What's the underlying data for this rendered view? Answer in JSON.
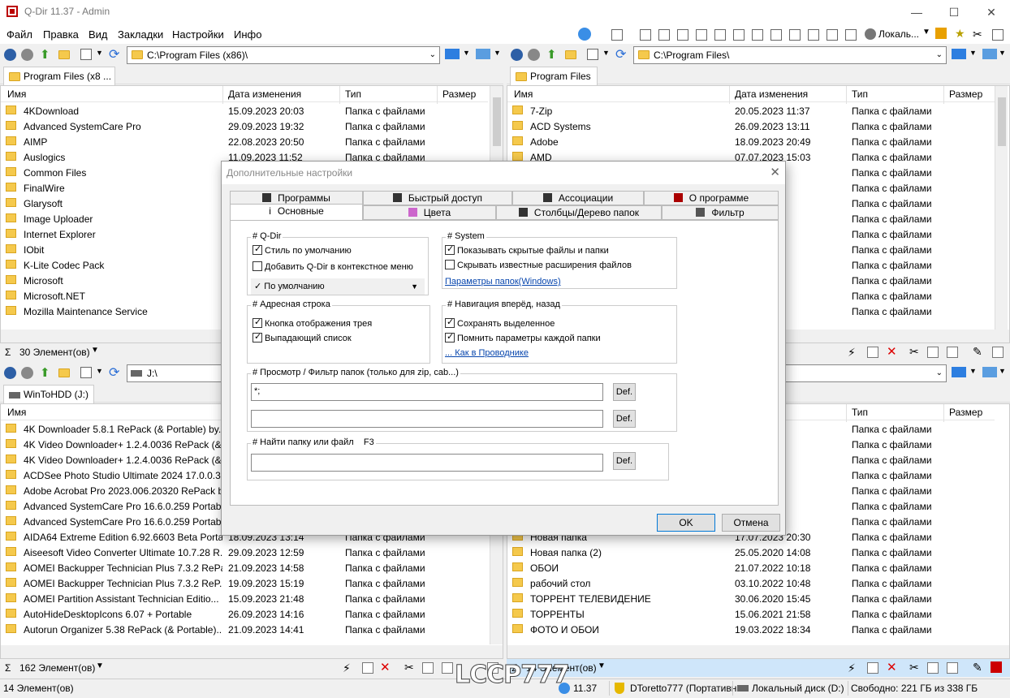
{
  "app": {
    "title": "Q-Dir 11.37 - Admin",
    "min": "—",
    "max": "☐",
    "close": "✕"
  },
  "menu": [
    "Файл",
    "Правка",
    "Вид",
    "Закладки",
    "Настройки",
    "Инфо"
  ],
  "toolbar": {
    "locale_label": "Локаль..."
  },
  "columns": {
    "name": "Имя",
    "date": "Дата изменения",
    "type": "Тип",
    "size": "Размер"
  },
  "pane_tl": {
    "path": "C:\\Program Files (x86)\\",
    "tab": "Program Files (x8 ...",
    "rows": [
      {
        "name": "4KDownload",
        "date": "15.09.2023 20:03",
        "type": "Папка с файлами"
      },
      {
        "name": "Advanced SystemCare Pro",
        "date": "29.09.2023 19:32",
        "type": "Папка с файлами"
      },
      {
        "name": "AIMP",
        "date": "22.08.2023 20:50",
        "type": "Папка с файлами"
      },
      {
        "name": "Auslogics",
        "date": "11.09.2023 11:52",
        "type": "Папка с файлами"
      },
      {
        "name": "Common Files",
        "date": "",
        "type": ""
      },
      {
        "name": "FinalWire",
        "date": "",
        "type": ""
      },
      {
        "name": "Glarysoft",
        "date": "",
        "type": ""
      },
      {
        "name": "Image Uploader",
        "date": "",
        "type": ""
      },
      {
        "name": "Internet Explorer",
        "date": "",
        "type": ""
      },
      {
        "name": "IObit",
        "date": "",
        "type": ""
      },
      {
        "name": "K-Lite Codec Pack",
        "date": "",
        "type": ""
      },
      {
        "name": "Microsoft",
        "date": "",
        "type": ""
      },
      {
        "name": "Microsoft.NET",
        "date": "",
        "type": ""
      },
      {
        "name": "Mozilla Maintenance Service",
        "date": "",
        "type": ""
      }
    ],
    "status": "30 Элемент(ов)"
  },
  "pane_tr": {
    "path": "C:\\Program Files\\",
    "tab": "Program Files",
    "rows": [
      {
        "name": "7-Zip",
        "date": "20.05.2023 11:37",
        "type": "Папка с файлами"
      },
      {
        "name": "ACD Systems",
        "date": "26.09.2023 13:11",
        "type": "Папка с файлами"
      },
      {
        "name": "Adobe",
        "date": "18.09.2023 20:49",
        "type": "Папка с файлами"
      },
      {
        "name": "AMD",
        "date": "07.07.2023 15:03",
        "type": "Папка с файлами"
      },
      {
        "name": "",
        "date": ":57",
        "type": "Папка с файлами"
      },
      {
        "name": "",
        "date": ":22",
        "type": "Папка с файлами"
      },
      {
        "name": "",
        "date": ":20",
        "type": "Папка с файлами"
      },
      {
        "name": "",
        "date": ":40",
        "type": "Папка с файлами"
      },
      {
        "name": "",
        "date": ":17",
        "type": "Папка с файлами"
      },
      {
        "name": "",
        "date": ":22",
        "type": "Папка с файлами"
      },
      {
        "name": "",
        "date": ":55",
        "type": "Папка с файлами"
      },
      {
        "name": "",
        "date": ":58",
        "type": "Папка с файлами"
      },
      {
        "name": "",
        "date": ":06",
        "type": "Папка с файлами"
      },
      {
        "name": "",
        "date": ":03",
        "type": "Папка с файлами"
      }
    ]
  },
  "pane_bl": {
    "path": "J:\\",
    "tab": "WinToHDD (J:)",
    "rows": [
      {
        "name": "4K Downloader 5.8.1 RePack (& Portable) by...",
        "date": "",
        "type": ""
      },
      {
        "name": "4K Video Downloader+ 1.2.4.0036 RePack (&...",
        "date": "",
        "type": ""
      },
      {
        "name": "4K Video Downloader+ 1.2.4.0036 RePack (&...",
        "date": "",
        "type": ""
      },
      {
        "name": "ACDSee Photo Studio Ultimate 2024 17.0.0.3...",
        "date": "",
        "type": ""
      },
      {
        "name": "Adobe Acrobat Pro 2023.006.20320 RePack b...",
        "date": "",
        "type": ""
      },
      {
        "name": "Advanced SystemCare Pro 16.6.0.259 Portab...",
        "date": "",
        "type": ""
      },
      {
        "name": "Advanced SystemCare Pro 16.6.0.259 Portab...",
        "date": "",
        "type": ""
      },
      {
        "name": "AIDA64 Extreme Edition 6.92.6603 Beta Porta...",
        "date": "18.09.2023 13:14",
        "type": "Папка с файлами"
      },
      {
        "name": "Aiseesoft Video Converter Ultimate 10.7.28 R...",
        "date": "29.09.2023 12:59",
        "type": "Папка с файлами"
      },
      {
        "name": "AOMEI Backupper Technician Plus 7.3.2 RePa...",
        "date": "21.09.2023 14:58",
        "type": "Папка с файлами"
      },
      {
        "name": "AOMEI Backupper Technician Plus 7.3.2 ReP...",
        "date": "19.09.2023 15:19",
        "type": "Папка с файлами"
      },
      {
        "name": "AOMEI Partition Assistant Technician Editio...",
        "date": "15.09.2023 21:48",
        "type": "Папка с файлами"
      },
      {
        "name": "AutoHideDesktopIcons 6.07 + Portable",
        "date": "26.09.2023 14:16",
        "type": "Папка с файлами"
      },
      {
        "name": "Autorun Organizer 5.38 RePack (& Portable)...",
        "date": "21.09.2023 14:41",
        "type": "Папка с файлами"
      }
    ],
    "status": "162 Элемент(ов)"
  },
  "pane_br": {
    "rows": [
      {
        "name": "",
        "date": ":29",
        "type": "Папка с файлами"
      },
      {
        "name": "",
        "date": ":14",
        "type": "Папка с файлами"
      },
      {
        "name": "",
        "date": ":17",
        "type": "Папка с файлами"
      },
      {
        "name": "",
        "date": ":29",
        "type": "Папка с файлами"
      },
      {
        "name": "",
        "date": ":38",
        "type": "Папка с файлами"
      },
      {
        "name": "",
        "date": ":29",
        "type": "Папка с файлами"
      },
      {
        "name": "",
        "date": ":24",
        "type": "Папка с файлами"
      },
      {
        "name": "Новая папка",
        "date": "17.07.2023 20:30",
        "type": "Папка с файлами"
      },
      {
        "name": "Новая папка (2)",
        "date": "25.05.2020 14:08",
        "type": "Папка с файлами"
      },
      {
        "name": "ОБОИ",
        "date": "21.07.2022 10:18",
        "type": "Папка с файлами"
      },
      {
        "name": "рабочий стол",
        "date": "03.10.2022 10:48",
        "type": "Папка с файлами"
      },
      {
        "name": "ТОРРЕНТ ТЕЛЕВИДЕНИЕ",
        "date": "30.06.2020 15:45",
        "type": "Папка с файлами"
      },
      {
        "name": "ТОРРЕНТЫ",
        "date": "15.06.2021 21:58",
        "type": "Папка с файлами"
      },
      {
        "name": "ФОТО И ОБОИ",
        "date": "19.03.2022 18:34",
        "type": "Папка с файлами"
      }
    ],
    "status": "14 Элемент(ов)"
  },
  "dialog": {
    "title": "Дополнительные настройки",
    "tabs_row1": [
      "Программы",
      "Быстрый доступ",
      "Ассоциации",
      "О программе"
    ],
    "tabs_row2": [
      "Основные",
      "Цвета",
      "Столбцы/Дерево папок",
      "Фильтр"
    ],
    "qdir": {
      "title": "# Q-Dir",
      "opt1": "Стиль по умолчанию",
      "opt2": "Добавить Q-Dir в контекстное меню",
      "combo": "По умолчанию"
    },
    "system": {
      "title": "# System",
      "opt1": "Показывать скрытые файлы и папки",
      "opt2": "Скрывать известные расширения файлов",
      "link": "Параметры папок(Windows)"
    },
    "address": {
      "title": "# Адресная строка",
      "opt1": "Кнопка отображения трея",
      "opt2": "Выпадающий список"
    },
    "nav": {
      "title": "# Навигация вперёд, назад",
      "opt1": "Сохранять выделенное",
      "opt2": "Помнить параметры каждой папки",
      "link": "... Как в Проводнике"
    },
    "filter": {
      "title": "# Просмотр / Фильтр папок (только для zip, cab...)",
      "value1": "*;",
      "value2": "",
      "def": "Def."
    },
    "find": {
      "title": "# Найти папку или файл    F3",
      "value": "",
      "def": "Def."
    },
    "ok": "OK",
    "cancel": "Отмена"
  },
  "bottom": {
    "count": "14 Элемент(ов)",
    "version": "11.37",
    "user": "DToretto777 (Портативн",
    "disk": "Локальный диск (D:)",
    "free": "Свободно: 221 ГБ из 338 ГБ"
  },
  "watermark": "LCCP777",
  "colors": {
    "accent": "#0078d7",
    "folder": "#f5c94c",
    "link": "#0645ad",
    "red": "#d00000"
  }
}
